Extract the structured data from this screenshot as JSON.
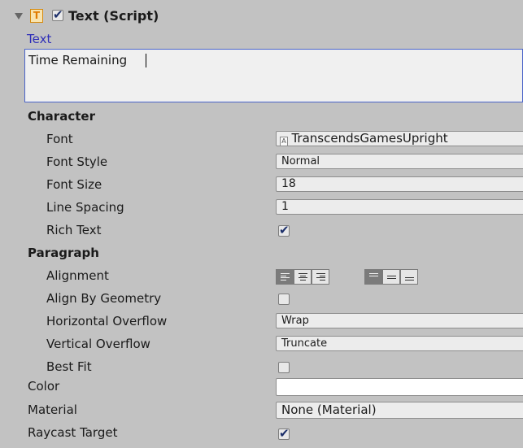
{
  "component": {
    "title": "Text (Script)",
    "enabled": true
  },
  "text_label": "Text",
  "text_value": "Time Remaining",
  "sections": {
    "character": "Character",
    "paragraph": "Paragraph"
  },
  "labels": {
    "font": "Font",
    "font_style": "Font Style",
    "font_size": "Font Size",
    "line_spacing": "Line Spacing",
    "rich_text": "Rich Text",
    "alignment": "Alignment",
    "align_by_geometry": "Align By Geometry",
    "horizontal_overflow": "Horizontal Overflow",
    "vertical_overflow": "Vertical Overflow",
    "best_fit": "Best Fit",
    "color": "Color",
    "material": "Material",
    "raycast_target": "Raycast Target"
  },
  "values": {
    "font": "TranscendsGamesUpright",
    "font_style": "Normal",
    "font_size": "18",
    "line_spacing": "1",
    "rich_text": true,
    "alignment_horizontal": "left",
    "alignment_vertical": "top",
    "align_by_geometry": false,
    "horizontal_overflow": "Wrap",
    "vertical_overflow": "Truncate",
    "best_fit": false,
    "color": "#ffffff",
    "material": "None (Material)",
    "raycast_target": true
  },
  "colors": {
    "accent": "#3030c8",
    "component_icon": "#f0a020"
  }
}
